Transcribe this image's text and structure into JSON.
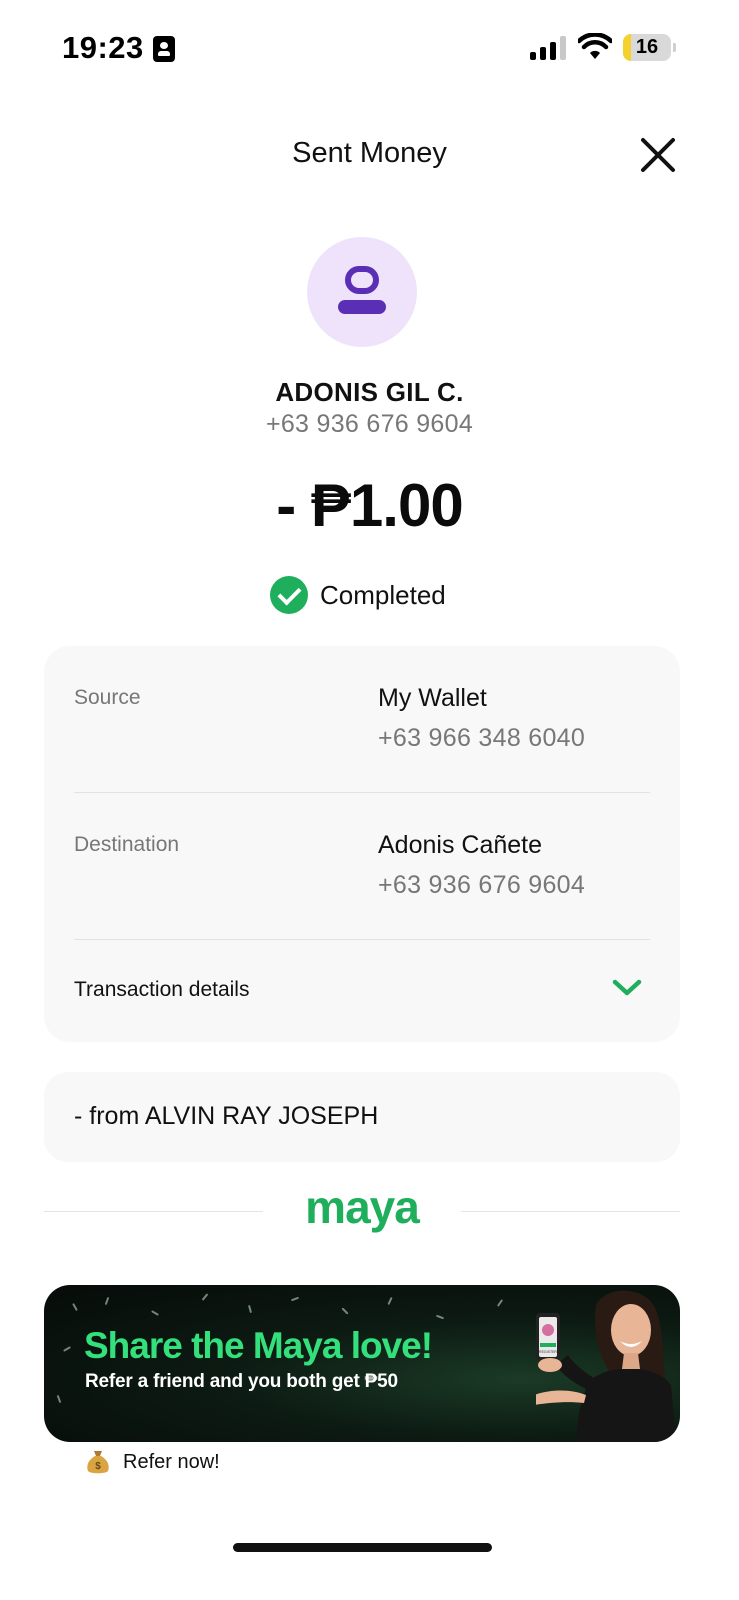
{
  "status_bar": {
    "time": "19:23",
    "battery": "16",
    "battery_level": 0.16
  },
  "header": {
    "title": "Sent Money"
  },
  "recipient": {
    "name": "ADONIS GIL C.",
    "phone": "+63 936 676 9604"
  },
  "amount": "- ₱1.00",
  "status": "Completed",
  "details": {
    "source_label": "Source",
    "source_name": "My Wallet",
    "source_number": "+63 966 348 6040",
    "destination_label": "Destination",
    "destination_name": "Adonis Cañete",
    "destination_number": "+63 936 676 9604",
    "transaction_details_label": "Transaction details"
  },
  "note": "- from ALVIN RAY JOSEPH",
  "brand": "maya",
  "banner": {
    "headline": "Share the Maya love!",
    "subtext": "Refer a friend and you both get ₱50",
    "phone_screen_text": "REGISTER"
  },
  "refer": {
    "label": "Refer now!"
  },
  "colors": {
    "accent_green": "#1fae5c",
    "avatar_purple": "#5b2fb5",
    "avatar_bg": "#efe3fb",
    "battery_yellow": "#f5d22b"
  }
}
